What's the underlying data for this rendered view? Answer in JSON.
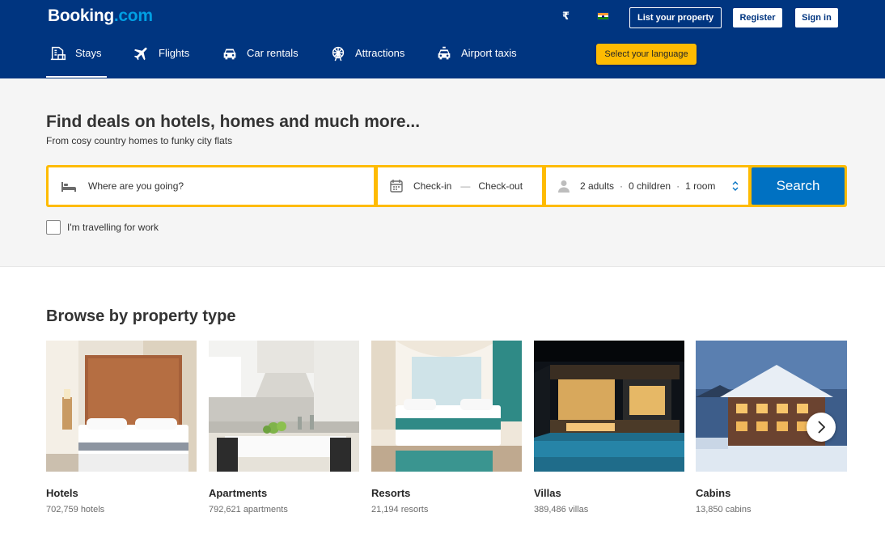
{
  "header": {
    "logo": {
      "main": "Booking",
      "suffix": ".com"
    },
    "currency": "₹",
    "list_property": "List your property",
    "register": "Register",
    "sign_in": "Sign in",
    "language_tooltip": "Select your language"
  },
  "nav": [
    {
      "label": "Stays",
      "icon": "bed-icon",
      "active": true
    },
    {
      "label": "Flights",
      "icon": "plane-icon"
    },
    {
      "label": "Car rentals",
      "icon": "car-icon"
    },
    {
      "label": "Attractions",
      "icon": "ferris-wheel-icon"
    },
    {
      "label": "Airport taxis",
      "icon": "taxi-icon"
    }
  ],
  "hero": {
    "title": "Find deals on hotels, homes and much more...",
    "subtitle": "From cosy country homes to funky city flats"
  },
  "search": {
    "destination_placeholder": "Where are you going?",
    "check_in": "Check-in",
    "check_out": "Check-out",
    "adults": "2 adults",
    "children": "0 children",
    "rooms": "1 room",
    "search_button": "Search",
    "work_travel": "I'm travelling for work"
  },
  "browse": {
    "title": "Browse by property type",
    "items": [
      {
        "name": "Hotels",
        "count": "702,759 hotels"
      },
      {
        "name": "Apartments",
        "count": "792,621 apartments"
      },
      {
        "name": "Resorts",
        "count": "21,194 resorts"
      },
      {
        "name": "Villas",
        "count": "389,486 villas"
      },
      {
        "name": "Cabins",
        "count": "13,850 cabins"
      }
    ]
  },
  "colors": {
    "header_bg": "#003580",
    "accent_yellow": "#febb02",
    "primary_blue": "#0071c2",
    "logo_dot": "#009fe3"
  }
}
